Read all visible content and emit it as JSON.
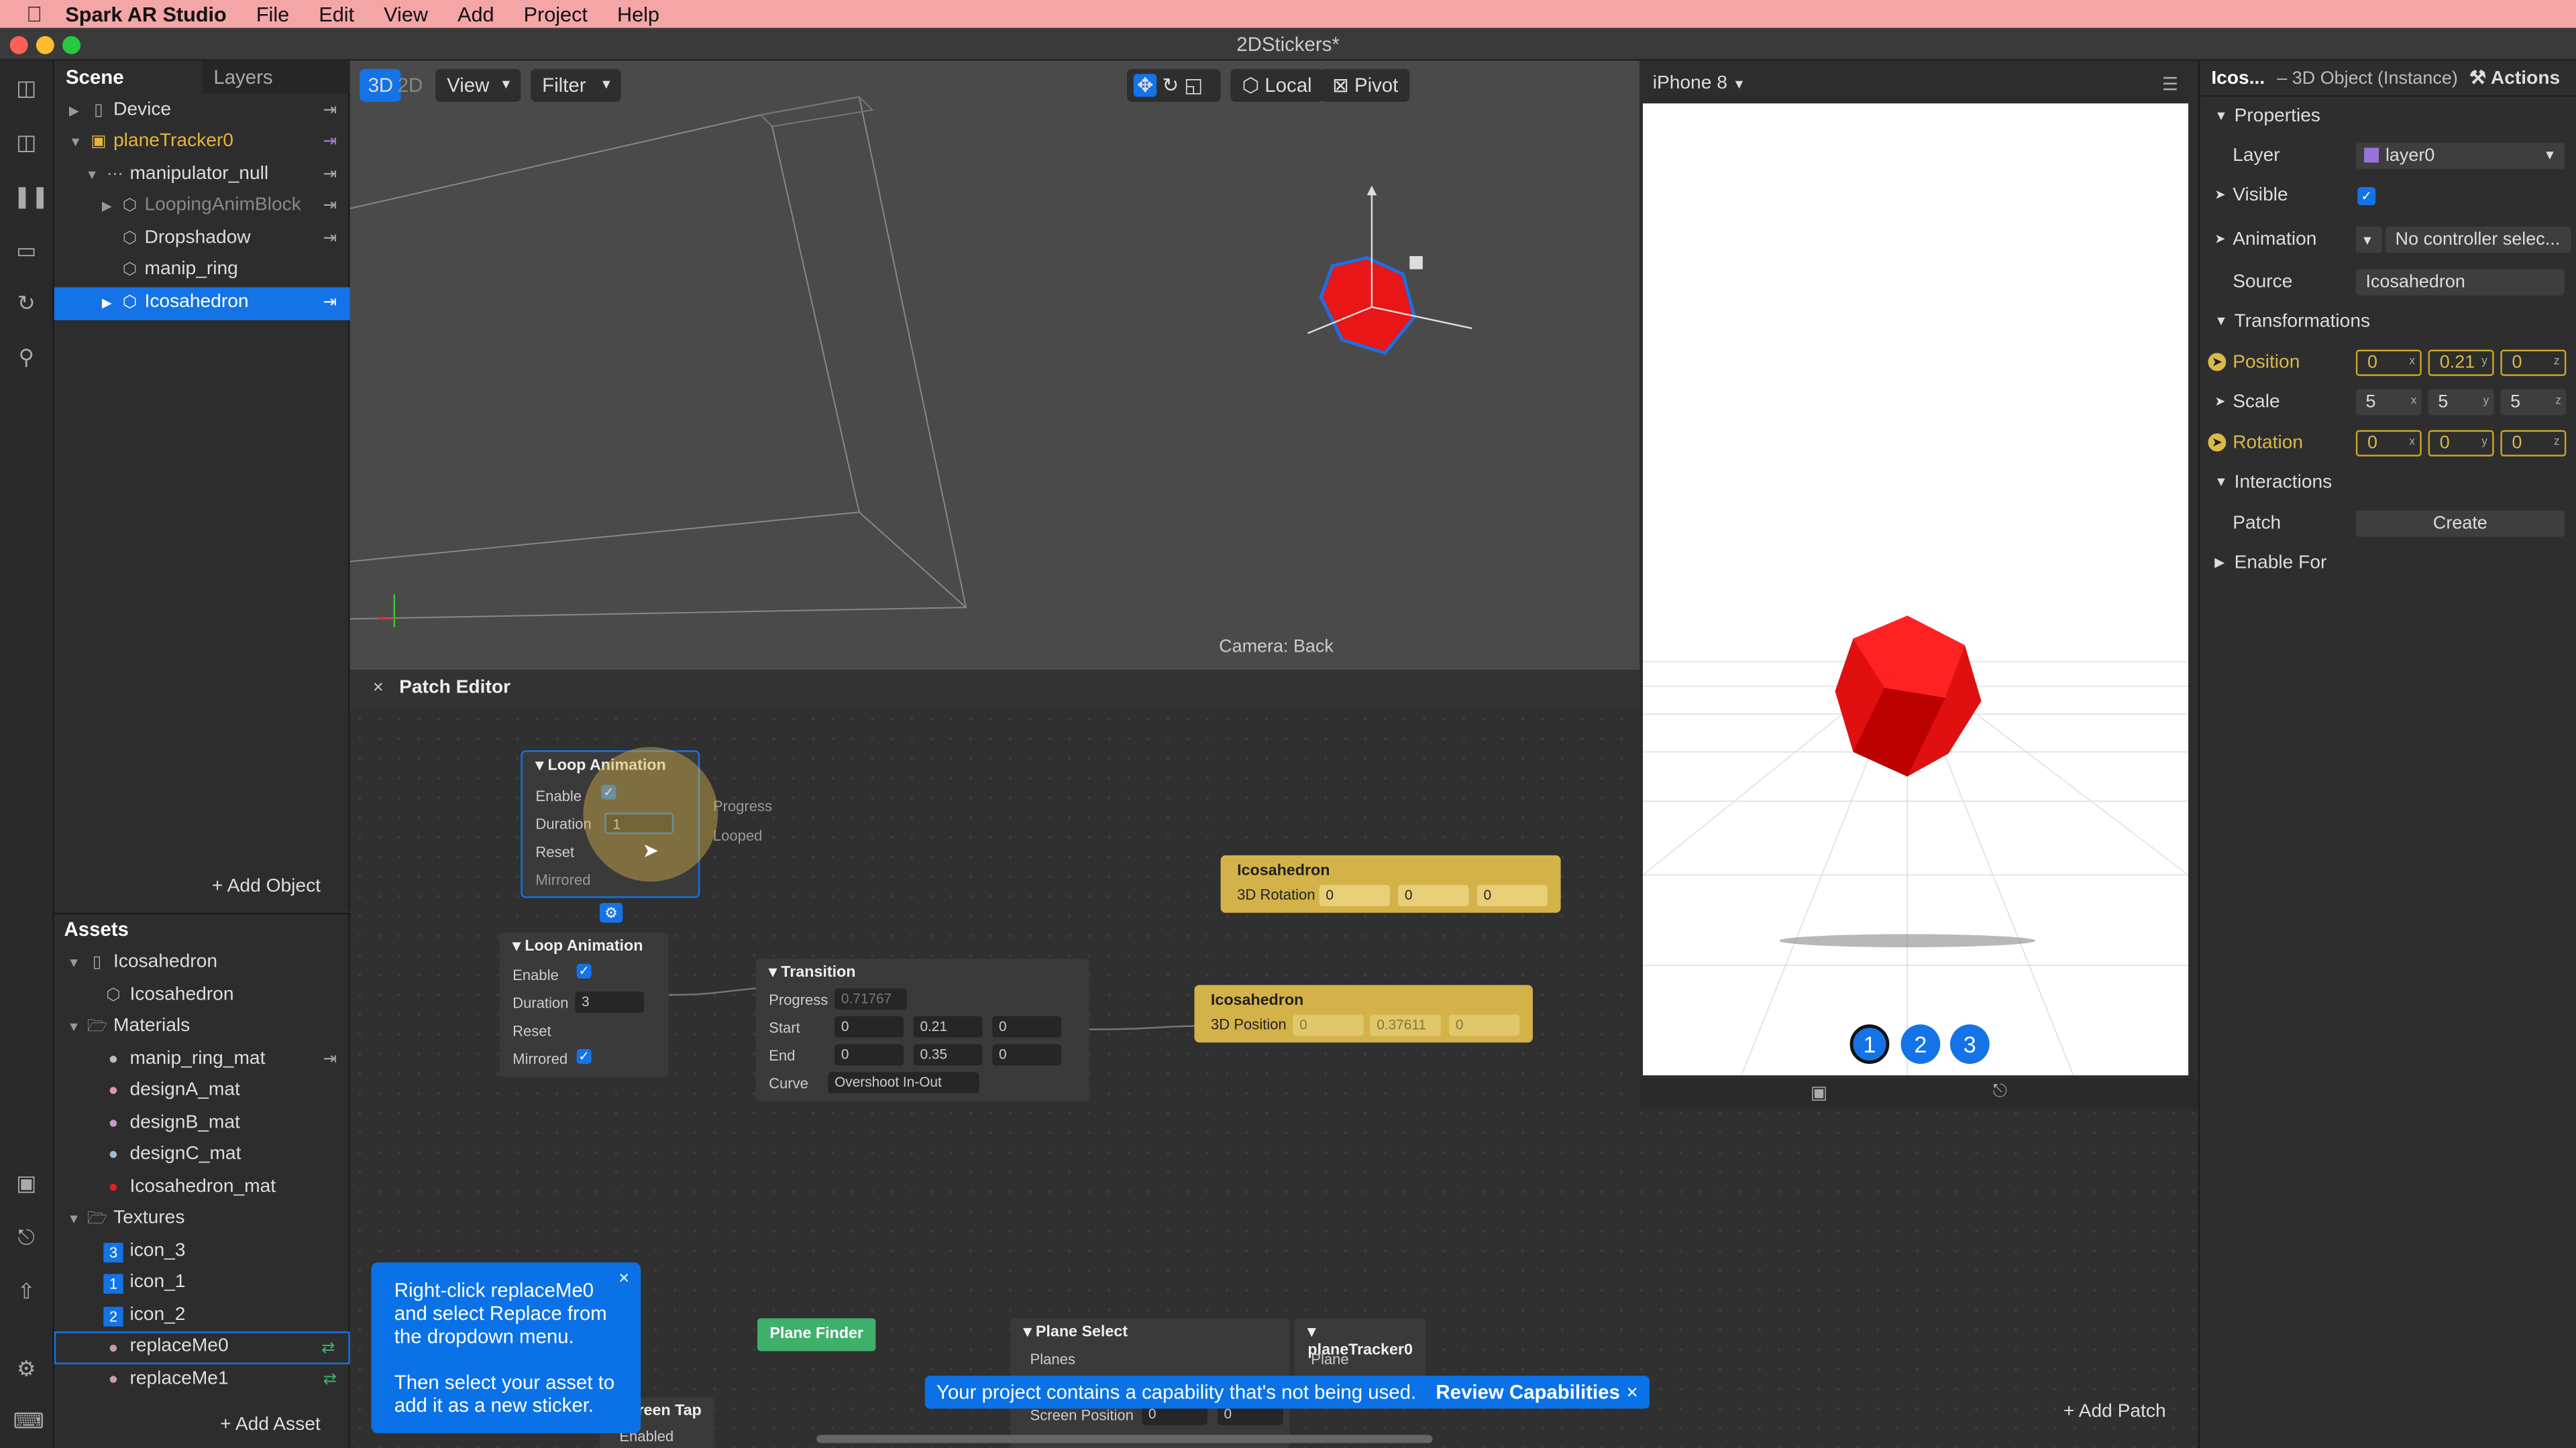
{
  "menubar": {
    "app": "Spark AR Studio",
    "items": [
      "File",
      "Edit",
      "View",
      "Add",
      "Project",
      "Help"
    ]
  },
  "window": {
    "title": "2DStickers*"
  },
  "scene_panel": {
    "tabs": [
      "Scene",
      "Layers"
    ],
    "tree": [
      {
        "label": "Device"
      },
      {
        "label": "planeTracker0"
      },
      {
        "label": "manipulator_null"
      },
      {
        "label": "LoopingAnimBlock"
      },
      {
        "label": "Dropshadow"
      },
      {
        "label": "manip_ring"
      },
      {
        "label": "Icosahedron"
      }
    ],
    "add_object": "+ Add Object"
  },
  "assets_panel": {
    "title": "Assets",
    "items": [
      {
        "label": "Icosahedron"
      },
      {
        "label": "Icosahedron"
      },
      {
        "label": "Materials"
      },
      {
        "label": "manip_ring_mat"
      },
      {
        "label": "designA_mat"
      },
      {
        "label": "designB_mat"
      },
      {
        "label": "designC_mat"
      },
      {
        "label": "Icosahedron_mat"
      },
      {
        "label": "Textures"
      },
      {
        "label": "icon_3",
        "badge": "3"
      },
      {
        "label": "icon_1",
        "badge": "1"
      },
      {
        "label": "icon_2",
        "badge": "2"
      },
      {
        "label": "replaceMe0"
      },
      {
        "label": "replaceMe1"
      }
    ],
    "add_asset": "+ Add Asset"
  },
  "viewport": {
    "mode_3d": "3D",
    "mode_2d": "2D",
    "view": "View",
    "filter": "Filter",
    "local": "Local",
    "pivot": "Pivot",
    "camera": "Camera: Back"
  },
  "patch_editor": {
    "title": "Patch Editor",
    "loop1": {
      "title": "Loop Animation",
      "enable": "Enable",
      "duration": "Duration",
      "duration_value": "1",
      "reset": "Reset",
      "mirrored": "Mirrored",
      "progress": "Progress",
      "looped": "Looped"
    },
    "loop2": {
      "title": "Loop Animation",
      "enable": "Enable",
      "duration": "Duration",
      "duration_value": "3",
      "reset": "Reset",
      "mirrored": "Mirrored"
    },
    "transition": {
      "title": "Transition",
      "progress": "Progress",
      "progress_value": "0.71767",
      "start": "Start",
      "start_x": "0",
      "start_y": "0.21",
      "start_z": "0",
      "end": "End",
      "end_x": "0",
      "end_y": "0.35",
      "end_z": "0",
      "curve": "Curve",
      "curve_value": "Overshoot In-Out"
    },
    "ico_rot": {
      "title": "Icosahedron",
      "label": "3D Rotation",
      "x": "0",
      "y": "0",
      "z": "0"
    },
    "ico_pos": {
      "title": "Icosahedron",
      "label": "3D Position",
      "x": "0",
      "y": "0.37611",
      "z": "0"
    },
    "plane_finder": "Plane Finder",
    "plane_select": {
      "title": "Plane Select",
      "planes": "Planes",
      "screen_position": "Screen Position",
      "sp_x": "0",
      "sp_y": "0"
    },
    "plane_tracker": {
      "title": "planeTracker0",
      "plane": "Plane"
    },
    "screen_tap": {
      "title": "reen Tap",
      "enabled": "Enabled"
    },
    "add_patch": "+ Add Patch"
  },
  "preview": {
    "device": "iPhone 8",
    "pager": [
      "1",
      "2",
      "3"
    ]
  },
  "inspector": {
    "title": "Icos...",
    "subtitle": "– 3D Object (Instance)",
    "actions": "Actions",
    "properties": "Properties",
    "layer_label": "Layer",
    "layer_value": "layer0",
    "visible_label": "Visible",
    "animation_label": "Animation",
    "animation_value": "No controller selec...",
    "source_label": "Source",
    "source_value": "Icosahedron",
    "transformations": "Transformations",
    "position_label": "Position",
    "position": [
      "0",
      "0.21",
      "0"
    ],
    "scale_label": "Scale",
    "scale": [
      "5",
      "5",
      "5"
    ],
    "rotation_label": "Rotation",
    "rotation": [
      "0",
      "0",
      "0"
    ],
    "interactions": "Interactions",
    "patch_label": "Patch",
    "patch_button": "Create",
    "enable_for": "Enable For"
  },
  "tooltip": {
    "line1": "Right-click replaceMe0 and select Replace from the dropdown menu.",
    "line2": "Then select your asset to add it as a new sticker."
  },
  "toast": {
    "message": "Your project contains a capability that's not being used.",
    "action": "Review Capabilities"
  },
  "colors": {
    "accent": "#1473e6",
    "menubar": "#f4a6a6",
    "patch_yellow": "#d4b24a",
    "plane_finder_green": "#3fb06b"
  }
}
